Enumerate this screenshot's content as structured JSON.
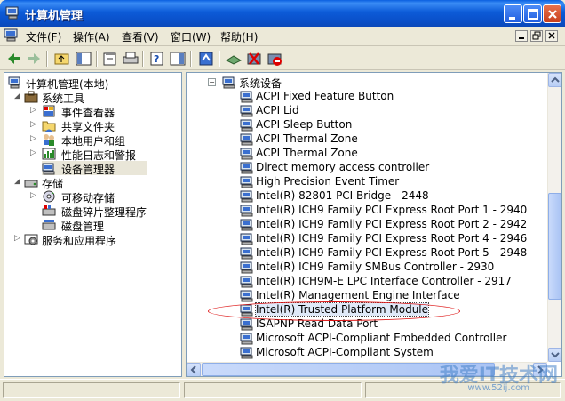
{
  "window": {
    "title": "计算机管理",
    "controls": [
      "minimize",
      "maximize",
      "close"
    ]
  },
  "menu": {
    "file": "文件(F)",
    "action": "操作(A)",
    "view": "查看(V)",
    "window": "窗口(W)",
    "help": "帮助(H)"
  },
  "toolbar": {
    "buttons": [
      "back-icon",
      "forward-icon",
      "up-icon",
      "show-tree-icon",
      "properties-icon",
      "print-icon",
      "help-icon",
      "export-icon",
      "update-driver-icon",
      "scan-icon",
      "uninstall-icon",
      "disable-icon"
    ]
  },
  "left_tree": {
    "root": "计算机管理(本地)",
    "system_tools": "系统工具",
    "event_viewer": "事件查看器",
    "shared_folders": "共享文件夹",
    "local_users": "本地用户和组",
    "perf_logs": "性能日志和警报",
    "device_manager": "设备管理器",
    "storage": "存储",
    "removable_storage": "可移动存储",
    "defrag": "磁盘碎片整理程序",
    "disk_mgmt": "磁盘管理",
    "services_apps": "服务和应用程序"
  },
  "right_tree": {
    "category": "系统设备",
    "devices": [
      "ACPI Fixed Feature Button",
      "ACPI Lid",
      "ACPI Sleep Button",
      "ACPI Thermal Zone",
      "ACPI Thermal Zone",
      "Direct memory access controller",
      "High Precision Event Timer",
      "Intel(R) 82801 PCI Bridge - 2448",
      "Intel(R) ICH9 Family PCI Express Root Port 1 - 2940",
      "Intel(R) ICH9 Family PCI Express Root Port 2 - 2942",
      "Intel(R) ICH9 Family PCI Express Root Port 4 - 2946",
      "Intel(R) ICH9 Family PCI Express Root Port 5 - 2948",
      "Intel(R) ICH9 Family SMBus Controller - 2930",
      "Intel(R) ICH9M-E LPC Interface Controller - 2917",
      "Intel(R) Management Engine Interface",
      "Intel(R) Trusted Platform Module",
      "ISAPNP Read Data Port",
      "Microsoft ACPI-Compliant Embedded Controller",
      "Microsoft ACPI-Compliant System"
    ],
    "highlighted_index": 15
  },
  "watermark": {
    "text": "我爱IT技术网",
    "url": "www.52ij.com"
  },
  "colors": {
    "titlebar": "#0a4fc8",
    "highlight_oval": "#dd1111",
    "pane_border": "#7f9db9"
  }
}
